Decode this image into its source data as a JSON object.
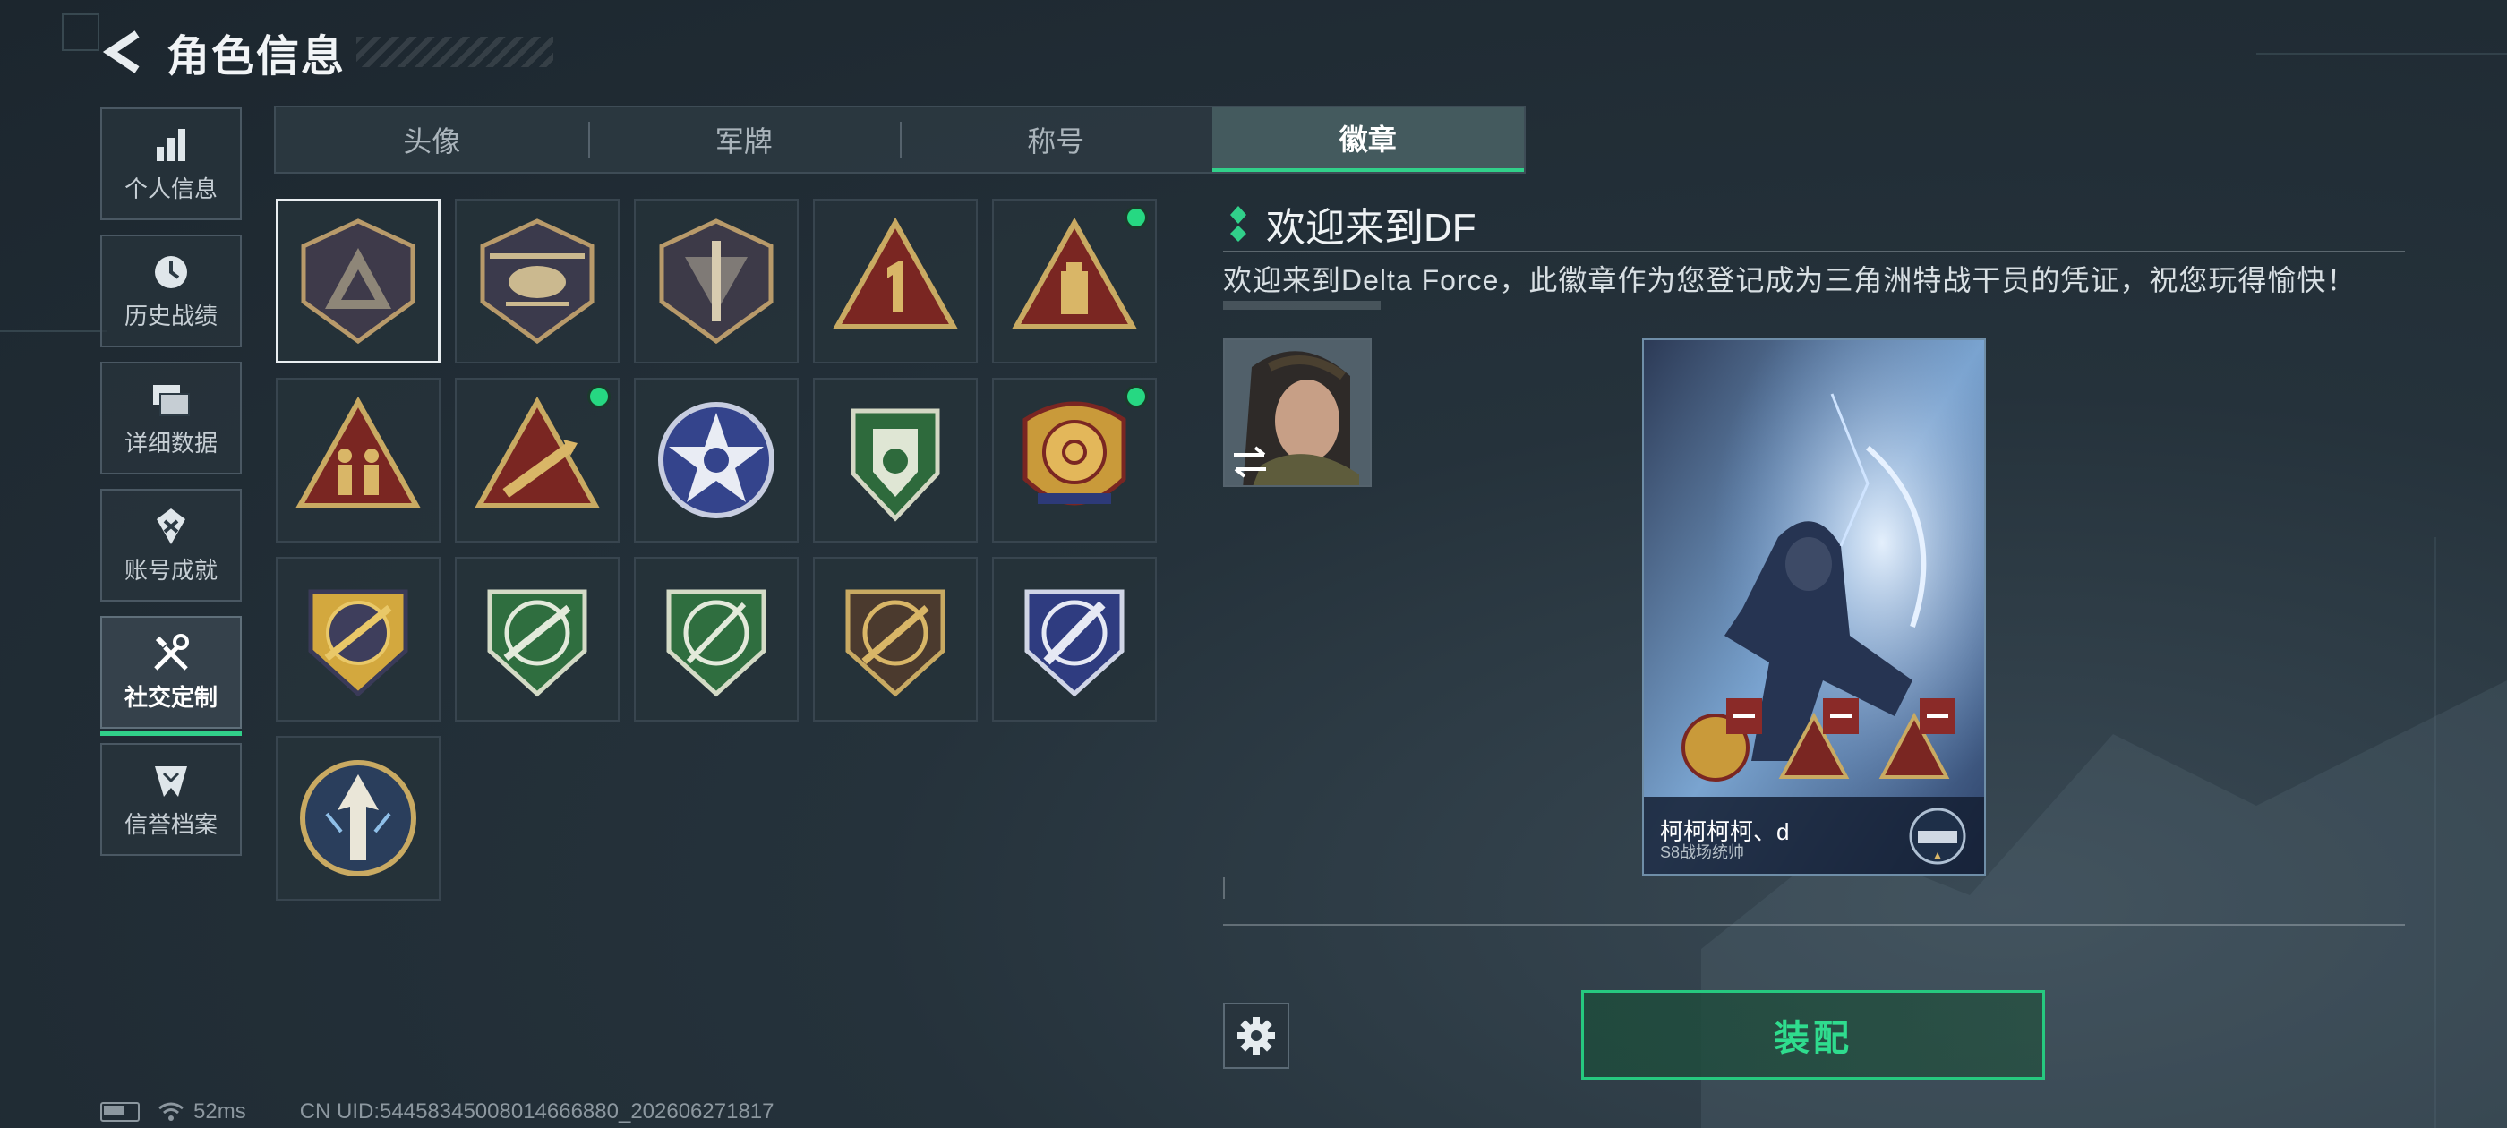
{
  "header": {
    "title": "角色信息",
    "back_icon": "back-arrow-icon"
  },
  "sidebar": {
    "items": [
      {
        "label": "个人信息",
        "icon": "bar-chart-icon",
        "active": false
      },
      {
        "label": "历史战绩",
        "icon": "clock-icon",
        "active": false
      },
      {
        "label": "详细数据",
        "icon": "folder-icon",
        "active": false
      },
      {
        "label": "账号成就",
        "icon": "achievement-icon",
        "active": false
      },
      {
        "label": "社交定制",
        "icon": "tools-icon",
        "active": true
      },
      {
        "label": "信誉档案",
        "icon": "shield-badge-icon",
        "active": false
      }
    ]
  },
  "tabs": [
    {
      "label": "头像",
      "active": false
    },
    {
      "label": "军牌",
      "active": false
    },
    {
      "label": "称号",
      "active": false
    },
    {
      "label": "徽章",
      "active": true
    }
  ],
  "badges": [
    {
      "icon": "delta-shield-badge-icon",
      "selected": true,
      "new": false
    },
    {
      "icon": "helicopter-badge-icon",
      "selected": false,
      "new": false
    },
    {
      "icon": "dagger-shield-badge-icon",
      "selected": false,
      "new": false
    },
    {
      "icon": "number-one-triangle-badge-icon",
      "selected": false,
      "new": false
    },
    {
      "icon": "usb-triangle-badge-icon",
      "selected": false,
      "new": true
    },
    {
      "icon": "soldiers-triangle-badge-icon",
      "selected": false,
      "new": false
    },
    {
      "icon": "rocket-triangle-badge-icon",
      "selected": false,
      "new": true
    },
    {
      "icon": "star-round-badge-icon",
      "selected": false,
      "new": false
    },
    {
      "icon": "green-arrows-shield-badge-icon",
      "selected": false,
      "new": false
    },
    {
      "icon": "crosshair-crest-badge-icon",
      "selected": false,
      "new": true
    },
    {
      "icon": "gold-rifle-crest-badge-icon",
      "selected": false,
      "new": false
    },
    {
      "icon": "green-rifle-crest-badge-icon",
      "selected": false,
      "new": false
    },
    {
      "icon": "green-sniper-crest-badge-icon",
      "selected": false,
      "new": false
    },
    {
      "icon": "brown-sniper-crest-badge-icon",
      "selected": false,
      "new": false
    },
    {
      "icon": "blue-knife-crest-badge-icon",
      "selected": false,
      "new": false
    },
    {
      "icon": "arrow-round-badge-icon",
      "selected": false,
      "new": false
    }
  ],
  "detail": {
    "title": "欢迎来到DF",
    "description": "欢迎来到Delta Force，此徽章作为您登记成为三角洲特战干员的凭证，祝您玩得愉快！"
  },
  "card": {
    "player_name": "柯柯柯柯、d",
    "player_title": "S8战场统帅"
  },
  "actions": {
    "equip_label": "装配",
    "settings_icon": "gear-icon"
  },
  "status": {
    "ping": "52ms",
    "uid": "CN UID:54458345008014666880_202606271817"
  },
  "colors": {
    "accent": "#31d08a",
    "background": "#25323b"
  }
}
